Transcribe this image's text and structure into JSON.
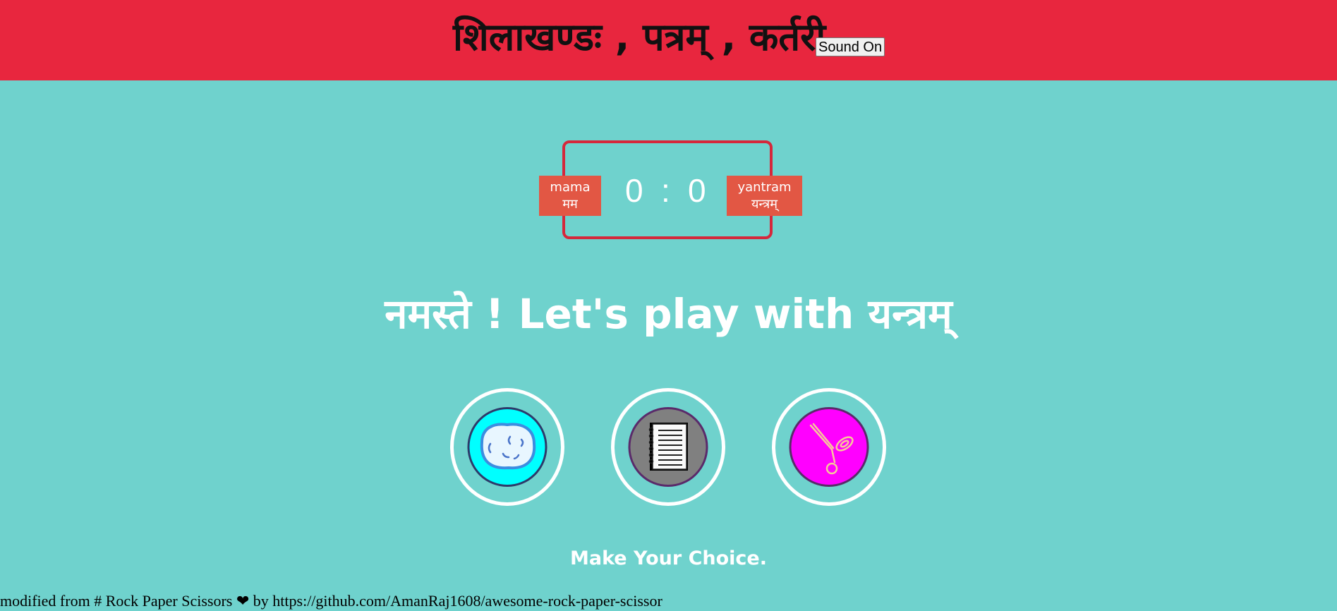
{
  "header": {
    "title": "शिलाखण्डः , पत्रम् , कर्तरी",
    "sound_button": "Sound On"
  },
  "scoreboard": {
    "user_label": "mama",
    "user_label_devanagari": "मम",
    "computer_label": "yantram",
    "computer_label_devanagari": "यन्त्रम्",
    "user_score": "0",
    "separator": ":",
    "computer_score": "0"
  },
  "message": "नमस्ते ! Let's play with यन्त्रम्",
  "choices": [
    {
      "name": "rock",
      "icon": "rock-icon",
      "color": "#00ffff"
    },
    {
      "name": "paper",
      "icon": "paper-icon",
      "color": "#808080"
    },
    {
      "name": "scissors",
      "icon": "scissors-icon",
      "color": "#ff00ff"
    }
  ],
  "prompt": "Make Your Choice.",
  "footer": {
    "text_before": "modified from # Rock Paper Scissors",
    "heart": "❤",
    "text_after": "by https://github.com/AmanRaj1608/awesome-rock-paper-scissor"
  },
  "colors": {
    "header_bg": "#e8263e",
    "page_bg": "#6fd2cd",
    "badge_bg": "#e25744",
    "score_border": "#d5283b"
  }
}
